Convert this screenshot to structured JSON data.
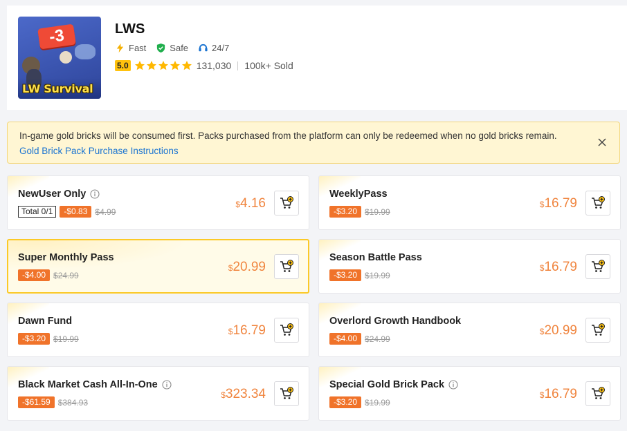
{
  "app": {
    "name": "LWS",
    "image_text": "LW Survival",
    "image_badge": "-3",
    "features": [
      "Fast",
      "Safe",
      "24/7"
    ],
    "rating": "5.0",
    "reviews": "131,030",
    "sold": "100k+ Sold"
  },
  "notice": {
    "text": "In-game gold bricks will be consumed first. Packs purchased from the platform can only be redeemed when no gold bricks remain.",
    "link": "Gold Brick Pack Purchase Instructions"
  },
  "currency": "$",
  "products": [
    {
      "name": "NewUser Only",
      "info": true,
      "total": "Total 0/1",
      "discount": "-$0.83",
      "original": "$4.99",
      "price": "4.16"
    },
    {
      "name": "WeeklyPass",
      "info": false,
      "discount": "-$3.20",
      "original": "$19.99",
      "price": "16.79"
    },
    {
      "name": "Super Monthly Pass",
      "info": false,
      "selected": true,
      "discount": "-$4.00",
      "original": "$24.99",
      "price": "20.99"
    },
    {
      "name": "Season Battle Pass",
      "info": false,
      "discount": "-$3.20",
      "original": "$19.99",
      "price": "16.79"
    },
    {
      "name": "Dawn Fund",
      "info": false,
      "discount": "-$3.20",
      "original": "$19.99",
      "price": "16.79"
    },
    {
      "name": "Overlord Growth Handbook",
      "info": false,
      "discount": "-$4.00",
      "original": "$24.99",
      "price": "20.99"
    },
    {
      "name": "Black Market Cash All-In-One",
      "info": true,
      "discount": "-$61.59",
      "original": "$384.93",
      "price": "323.34"
    },
    {
      "name": "Special Gold Brick Pack",
      "info": true,
      "discount": "-$3.20",
      "original": "$19.99",
      "price": "16.79"
    }
  ],
  "colors": {
    "accent": "#f0732a",
    "price": "#f0853f",
    "link": "#1b74d1",
    "rating": "#ffc20e",
    "selected_border": "#fbc927"
  }
}
